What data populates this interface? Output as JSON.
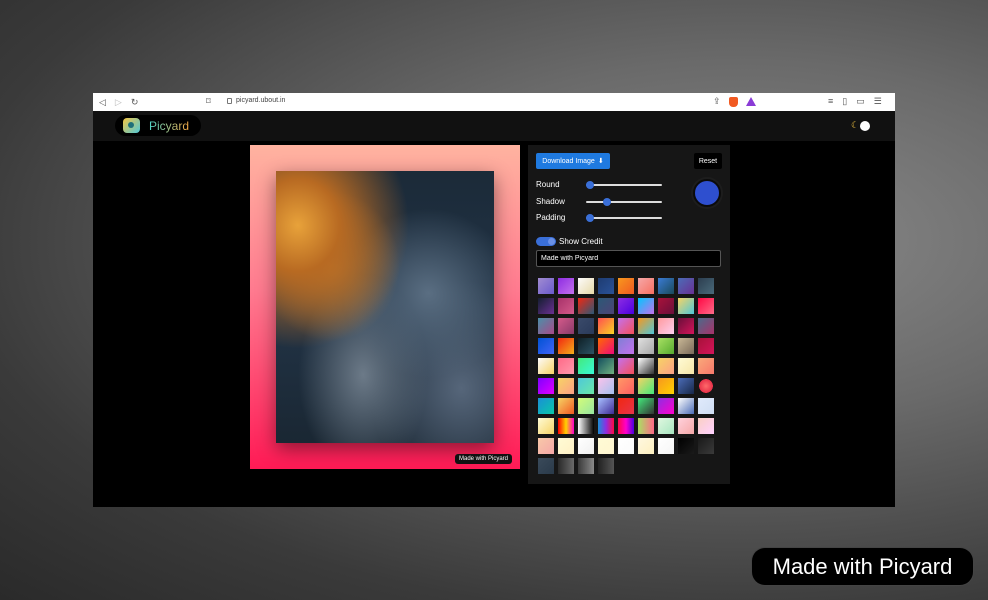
{
  "browser": {
    "url": "picyard.ubout.in",
    "nav_icons": [
      "back-icon",
      "forward-icon",
      "reload-icon"
    ]
  },
  "app": {
    "logo_text": "Picyard"
  },
  "editor": {
    "download_label": "Download Image",
    "download_icon": "download-icon",
    "reset_label": "Reset",
    "sliders": [
      {
        "label": "Round",
        "value": 0
      },
      {
        "label": "Shadow",
        "value": 0.25
      },
      {
        "label": "Padding",
        "value": 0
      }
    ],
    "selected_color": "#2e4fcf",
    "show_credit_label": "Show Credit",
    "show_credit_on": true,
    "credit_text": "Made with Picyard",
    "swatches": [
      "linear-gradient(135deg,#a18cd1,#6a5acd)",
      "linear-gradient(135deg,#8e2de2,#c471ed)",
      "linear-gradient(135deg,#fdfbfb,#e6d9a8)",
      "linear-gradient(135deg,#1e3c72,#2a5298)",
      "linear-gradient(135deg,#f7971e,#f15a22)",
      "linear-gradient(135deg,#f5a8a8,#f77062)",
      "linear-gradient(135deg,#3a7bd5,#1a4a5a)",
      "linear-gradient(135deg,#4b6cb7,#6a3093)",
      "linear-gradient(135deg,#2c3e50,#4a6a7a)",
      "linear-gradient(135deg,#141e30,#6a3093)",
      "linear-gradient(135deg,#a8326a,#d45a8a)",
      "linear-gradient(135deg,#f12711,#2b5876)",
      "linear-gradient(135deg,#2b5876,#4e4376)",
      "linear-gradient(135deg,#8e2de2,#4a00e0)",
      "linear-gradient(135deg,#00c6ff,#c471ed)",
      "linear-gradient(135deg,#a8123a,#6a0f3a)",
      "linear-gradient(135deg,#f6d365,#4ec8d9)",
      "linear-gradient(135deg,#ff0844,#ff6a88)",
      "linear-gradient(135deg,#4a8fa8,#a84a8a)",
      "linear-gradient(135deg,#d45a8a,#8a3a6a)",
      "linear-gradient(135deg,#3a4a6a,#2a3a5a)",
      "linear-gradient(135deg,#ff4e50,#f9d423)",
      "linear-gradient(135deg,#c471ed,#f64f59)",
      "linear-gradient(135deg,#f7971e,#4ec8d9)",
      "linear-gradient(135deg,#ff9a9e,#fecfef)",
      "linear-gradient(135deg,#6a0f3a,#d4145a)",
      "linear-gradient(135deg,#4a6a8a,#a8326a)",
      "linear-gradient(135deg,#0052d4,#4364f7)",
      "linear-gradient(135deg,#f12711,#f5af19)",
      "linear-gradient(135deg,#0f2027,#2c5364)",
      "linear-gradient(135deg,#ff6a00,#ee0979)",
      "linear-gradient(135deg,#7f7fd5,#c471ed)",
      "linear-gradient(135deg,#e0e0e0,#a8a8a8)",
      "linear-gradient(135deg,#a8e063,#56ab2f)",
      "linear-gradient(135deg,#c9b896,#7a6a5a)",
      "linear-gradient(135deg,#a8123a,#d4145a)",
      "linear-gradient(135deg,#fdfbfb,#f6d365)",
      "linear-gradient(135deg,#ff6a88,#ff99ac)",
      "linear-gradient(135deg,#43e97b,#38f9d7)",
      "linear-gradient(135deg,#134e5e,#71b280)",
      "linear-gradient(135deg,#c471ed,#f64f59)",
      "linear-gradient(135deg,#ffffff,#333333)",
      "linear-gradient(135deg,#f6d365,#fda085)",
      "linear-gradient(135deg,#fffbd5,#f6e6a8)",
      "linear-gradient(135deg,#f8a97a,#f7786b)",
      "linear-gradient(135deg,#7f00ff,#e100ff)",
      "linear-gradient(135deg,#f6d365,#fda085)",
      "linear-gradient(135deg,#4ec8d9,#6ae8a8)",
      "linear-gradient(135deg,#fbc2eb,#a6c1ee)",
      "linear-gradient(135deg,#ff9966,#ff5e62)",
      "linear-gradient(135deg,#f6d365,#43e97b)",
      "linear-gradient(135deg,#f7971e,#ffd200)",
      "linear-gradient(135deg,#4b6cb7,#182848)",
      "radial-gradient(circle,#ff6a6a 0%,#e8334a 60%,#161616 62%)",
      "linear-gradient(135deg,#1a8fd6,#0ac9a8)",
      "linear-gradient(135deg,#f6d365,#f15a22)",
      "linear-gradient(135deg,#d4fc79,#96e6a1)",
      "linear-gradient(135deg,#a8c0ff,#3f2b96)",
      "linear-gradient(135deg,#f12711,#e8334a)",
      "linear-gradient(135deg,#43e97b,#333333)",
      "linear-gradient(135deg,#8e2de2,#ff00cc)",
      "linear-gradient(135deg,#ffffff,#4b6cb7)",
      "linear-gradient(135deg,#e0eafc,#cfdef3)",
      "linear-gradient(135deg,#fffbd5,#f6d365)",
      "linear-gradient(90deg,#ff0000,#ffd200,#ff00cc)",
      "linear-gradient(90deg,#ffffff,#000000)",
      "linear-gradient(90deg,#1a8fd6,#8e2de2,#ff0844)",
      "linear-gradient(90deg,#ff0844,#ff00cc,#4b00e0)",
      "linear-gradient(90deg,#a8e063,#ff6a88)",
      "linear-gradient(135deg,#e0f7e0,#a8e6c0)",
      "linear-gradient(135deg,#ffd1dc,#f5a8a8)",
      "linear-gradient(135deg,#fad0c4,#ffd1ff)",
      "linear-gradient(135deg,#f8c8a8,#f5a8a8)",
      "linear-gradient(135deg,#fffbd5,#fff1c5)",
      "linear-gradient(135deg,#ffffff,#f0f0f0)",
      "linear-gradient(135deg,#fffbd5,#fff6d0)",
      "linear-gradient(135deg,#ffffff,#fafafa)",
      "linear-gradient(135deg,#fff8e0,#fdf0c0)",
      "linear-gradient(135deg,#ffffff,#f5f5f5)",
      "linear-gradient(135deg,#000000,#1a1a1a)",
      "linear-gradient(135deg,#1a1a1a,#3a3a3a)",
      "linear-gradient(135deg,#3a4a5a,#2a3a4a)",
      "linear-gradient(90deg,#2a2a2a,#6a6a6a)",
      "linear-gradient(90deg,#3a3a3a,#8a8a8a)",
      "linear-gradient(90deg,#222222,#555555)"
    ]
  },
  "watermark": {
    "text": "Made with Picyard"
  }
}
